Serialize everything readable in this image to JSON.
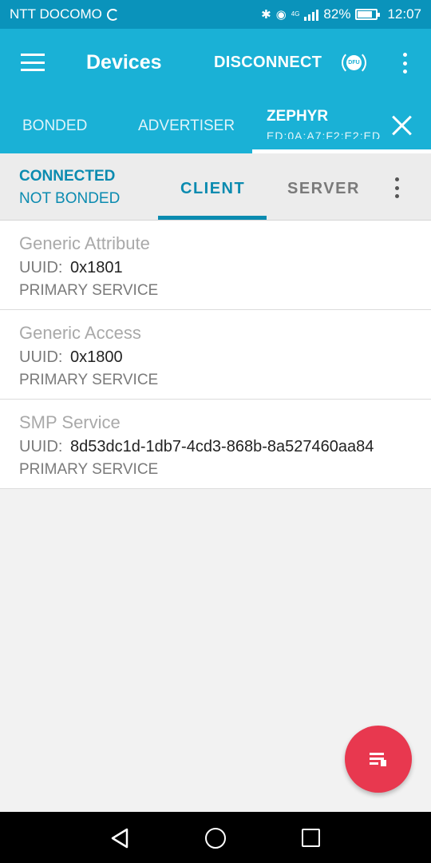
{
  "status_bar": {
    "carrier": "NTT DOCOMO",
    "network_type": "4G",
    "battery": "82%",
    "time": "12:07",
    "battery_level": 0.82
  },
  "app_bar": {
    "title": "Devices",
    "disconnect_label": "DISCONNECT",
    "dfu_label": "DFU"
  },
  "device_tabs": {
    "bonded": "BONDED",
    "advertiser": "ADVERTISER",
    "active_name": "ZEPHYR",
    "active_address": "ED:0A:A7:F2:E2:ED"
  },
  "connection": {
    "status": "CONNECTED",
    "bond": "NOT BONDED",
    "tabs": {
      "client": "CLIENT",
      "server": "SERVER"
    }
  },
  "services": [
    {
      "name": "Generic Attribute",
      "uuid_label": "UUID:",
      "uuid": "0x1801",
      "type": "PRIMARY SERVICE"
    },
    {
      "name": "Generic Access",
      "uuid_label": "UUID:",
      "uuid": "0x1800",
      "type": "PRIMARY SERVICE"
    },
    {
      "name": "SMP Service",
      "uuid_label": "UUID:",
      "uuid": "8d53dc1d-1db7-4cd3-868b-8a527460aa84",
      "type": "PRIMARY SERVICE"
    }
  ],
  "colors": {
    "status_bar": "#0a93bb",
    "app_bar": "#1ab1d6",
    "accent": "#0b8bb0",
    "fab": "#e8384f"
  },
  "icons": {
    "menu": "menu-icon",
    "dfu": "dfu-icon",
    "overflow": "overflow-menu-icon",
    "close": "close-icon",
    "fab": "log-list-icon",
    "nav_back": "back-triangle-icon",
    "nav_home": "home-circle-icon",
    "nav_recents": "recents-square-icon"
  }
}
